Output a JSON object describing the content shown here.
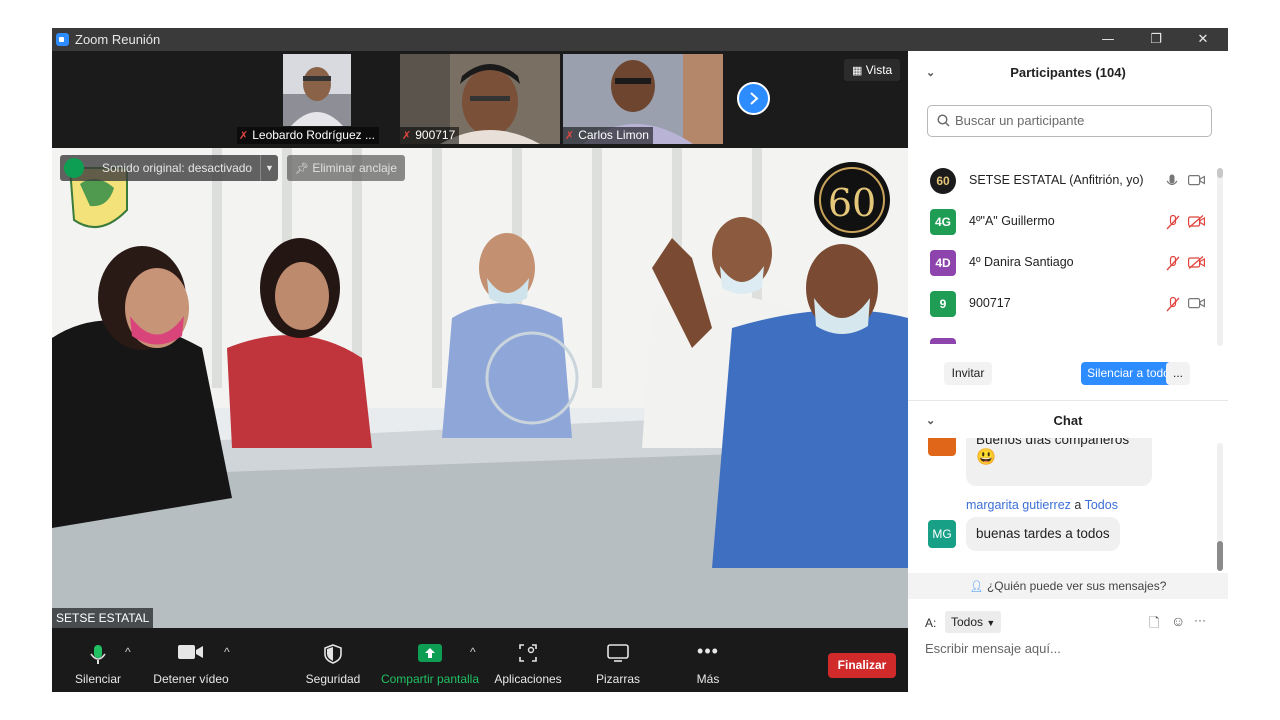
{
  "window": {
    "title": "Zoom Reunión",
    "controls": [
      "—",
      "❐",
      "✕"
    ]
  },
  "thumbnails": [
    {
      "name": "Leobardo Rodríguez ...",
      "muted": true,
      "bg": "#c7c9cf"
    },
    {
      "name": "900717",
      "muted": true,
      "bg": "#6b6258"
    },
    {
      "name": "Carlos Limon",
      "muted": true,
      "bg": "#8a8f9a"
    }
  ],
  "view_button": {
    "label": "Vista"
  },
  "main_video": {
    "sound_label": "Sonido original: desactivado",
    "unpin_label": "Eliminar anclaje",
    "speaker_name": "SETSE ESTATAL",
    "logo_badge": "60"
  },
  "toolbar": {
    "mute": "Silenciar",
    "video": "Detener vídeo",
    "security": "Seguridad",
    "share": "Compartir pantalla",
    "apps": "Aplicaciones",
    "whiteboards": "Pizarras",
    "more": "Más",
    "end": "Finalizar"
  },
  "participants": {
    "title": "Participantes (104)",
    "search_placeholder": "Buscar un participante",
    "list": [
      {
        "initials": "60",
        "name": "SETSE ESTATAL (Anfitrión, yo)",
        "color": "#1b1b1b",
        "mic_muted": false,
        "cam_off": false
      },
      {
        "initials": "4G",
        "name": "4º\"A\" Guillermo",
        "color": "#1f9d55",
        "mic_muted": true,
        "cam_off": true
      },
      {
        "initials": "4D",
        "name": "4º Danira Santiago",
        "color": "#8e44ad",
        "mic_muted": true,
        "cam_off": true
      },
      {
        "initials": "9",
        "name": "900717",
        "color": "#1f9d55",
        "mic_muted": true,
        "cam_off": false
      }
    ],
    "invite": "Invitar",
    "mute_all": "Silenciar a todos",
    "more": "..."
  },
  "chat": {
    "title": "Chat",
    "messages": [
      {
        "text": "Buenos días compañeros",
        "emoji": "😃",
        "avatar_color": "#e0671a"
      },
      {
        "sender": "margarita gutierrez",
        "to_word": "a",
        "to": "Todos",
        "initials": "MG",
        "avatar_color": "#17a085",
        "text": "buenas tardes a todos"
      }
    ],
    "who_can_see": "¿Quién puede ver sus mensajes?",
    "to_label": "A:",
    "to_value": "Todos",
    "compose_placeholder": "Escribir mensaje aquí..."
  },
  "colors": {
    "accent": "#2d8cff",
    "share_green": "#0e9e53",
    "end_red": "#d12a2a"
  }
}
